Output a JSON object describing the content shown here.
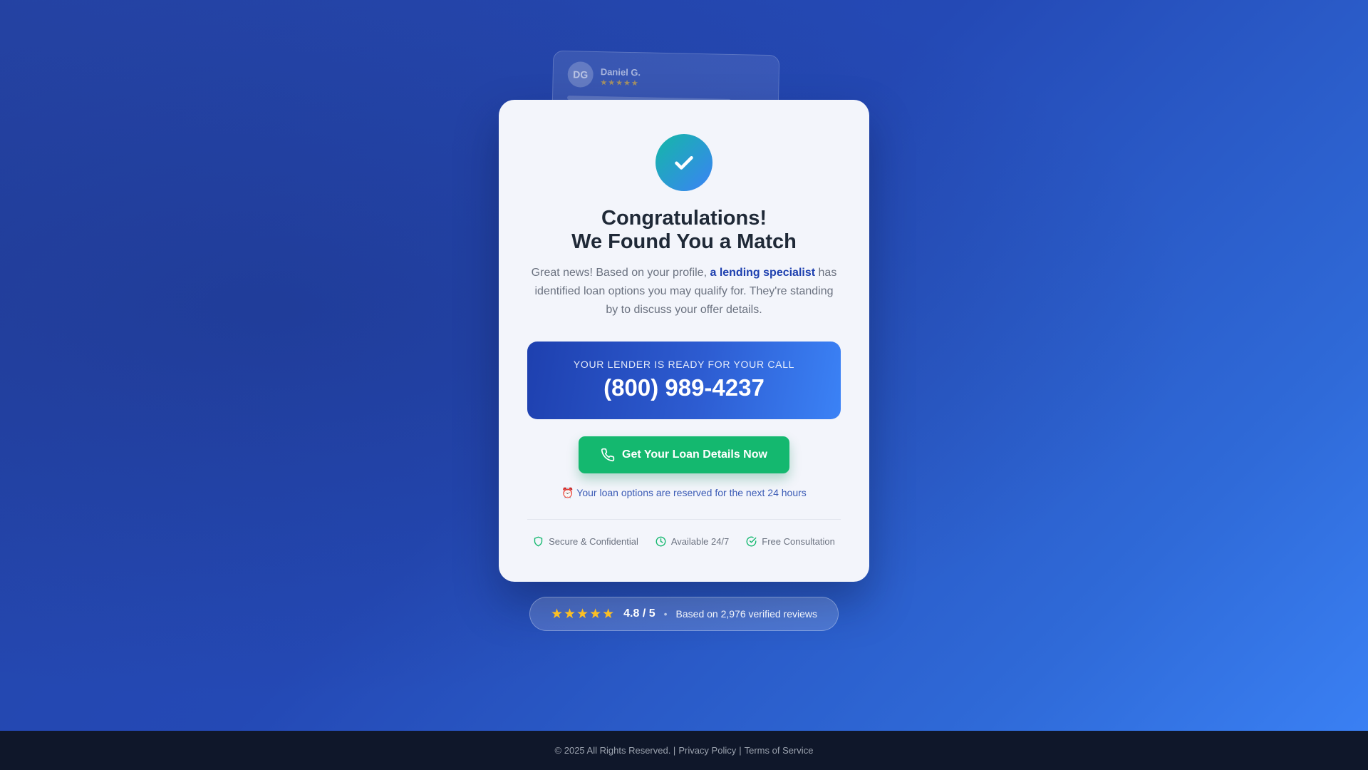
{
  "testimonial": {
    "initials": "DG",
    "name": "Daniel G.",
    "stars": "★★★★★"
  },
  "card": {
    "title_line1": "Congratulations!",
    "title_line2": "We Found You a Match",
    "desc_before": "Great news! Based on your profile, ",
    "desc_highlight": "a lending specialist",
    "desc_after": " has identified loan options you may qualify for. They're standing by to discuss your offer details.",
    "lender_label": "YOUR LENDER IS READY FOR YOUR CALL",
    "phone": "(800) 989-4237",
    "cta_label": "Get Your Loan Details Now",
    "reserve_icon": "⏰",
    "reserve_text": "Your loan options are reserved for the next 24 hours",
    "trust": [
      {
        "icon": "shield-icon",
        "label": "Secure & Confidential"
      },
      {
        "icon": "clock-icon",
        "label": "Available 24/7"
      },
      {
        "icon": "check-circle-icon",
        "label": "Free Consultation"
      }
    ]
  },
  "rating": {
    "stars": "★★★★★",
    "score": "4.8 / 5",
    "separator": "•",
    "text": "Based on 2,976 verified reviews"
  },
  "footer": {
    "copyright": "© 2025 All Rights Reserved. |",
    "privacy": "Privacy Policy",
    "sep": "|",
    "terms": "Terms of Service"
  },
  "colors": {
    "accent_green": "#14b86f",
    "accent_blue": "#1e40af",
    "star": "#fbbf24"
  }
}
